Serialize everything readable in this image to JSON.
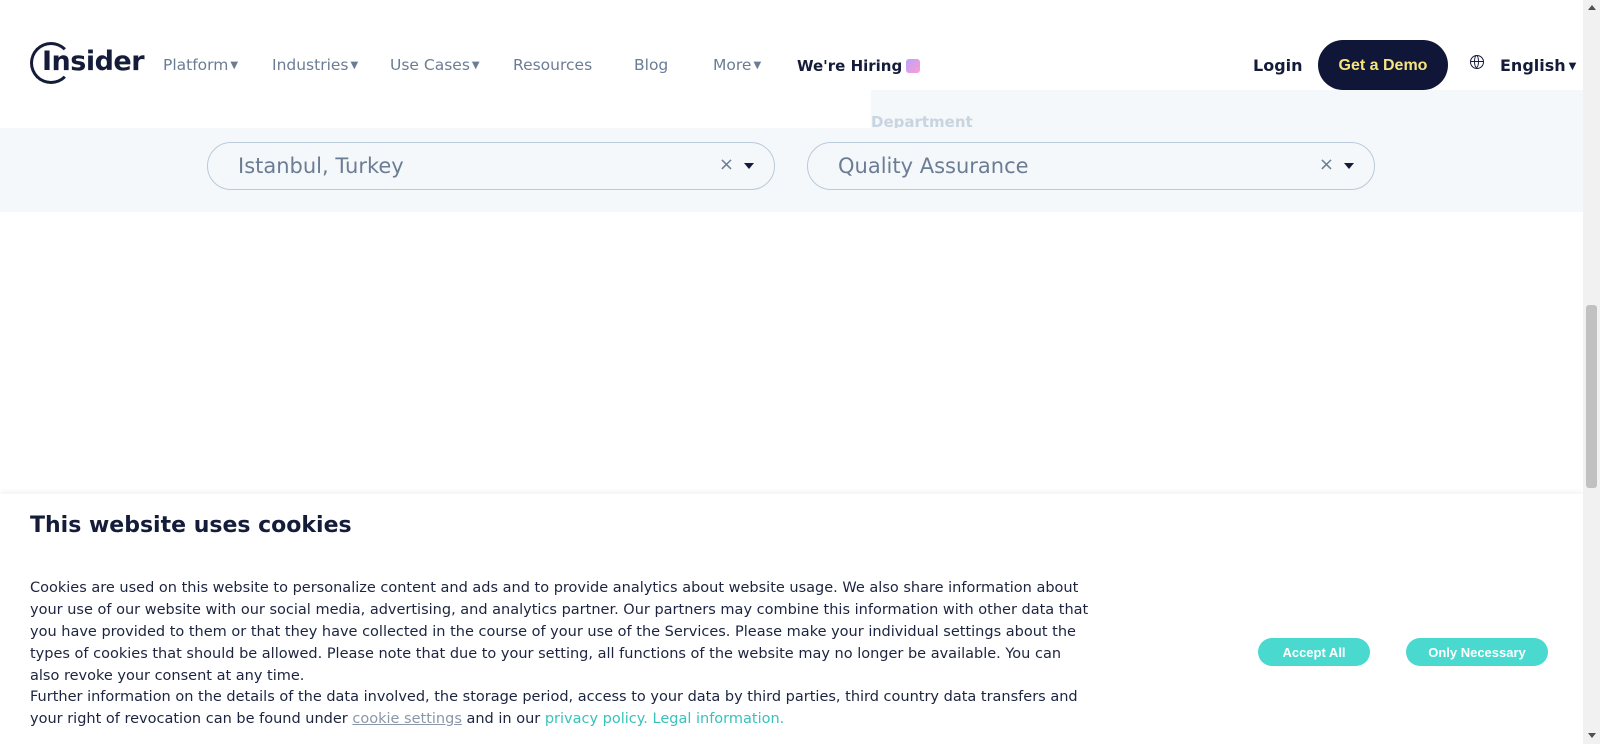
{
  "header": {
    "logo_text": "Insider",
    "nav": [
      {
        "label": "Platform",
        "dropdown": "▼"
      },
      {
        "label": "Industries",
        "dropdown": "▼"
      },
      {
        "label": "Use Cases",
        "dropdown": "▼"
      },
      {
        "label": "Resources"
      },
      {
        "label": "Blog"
      },
      {
        "label": "More",
        "dropdown": "▼"
      }
    ],
    "hiring_label": "We're Hiring",
    "login_label": "Login",
    "demo_label": "Get a Demo",
    "language_label": "English",
    "language_arrow": "▼"
  },
  "filters": {
    "department_label": "Department",
    "location": {
      "value": "Istanbul, Turkey",
      "clear": "×"
    },
    "department": {
      "value": "Quality Assurance",
      "clear": "×"
    }
  },
  "cookie_banner": {
    "title": "This website uses cookies",
    "paragraph1": "Cookies are used on this website to personalize content and ads and to provide analytics about website usage. We also share information about your use of our website with our social media, advertising, and analytics partner. Our partners may combine this information with other data that you have provided to them or that they have collected in the course of your use of the Services. Please make your individual settings about the types of cookies that should be allowed. Please note that due to your setting, all functions of the website may no longer be available. You can also revoke your consent at any time.",
    "paragraph2_prefix": "Further information on the details of the data involved, the storage period, access to your data by third parties, third country data transfers and your right of revocation can be found under",
    "cookie_settings_link": "cookie settings",
    "paragraph2_middle": "and in our",
    "privacy_link": "privacy policy.",
    "legal_link": "Legal information.",
    "accept_all": "Accept All",
    "only_necessary": "Only Necessary"
  },
  "colors": {
    "brand_dark": "#0f1638",
    "demo_text": "#f7e57a",
    "accent_teal": "#4ad9cf",
    "muted_text": "#6b7d94"
  }
}
